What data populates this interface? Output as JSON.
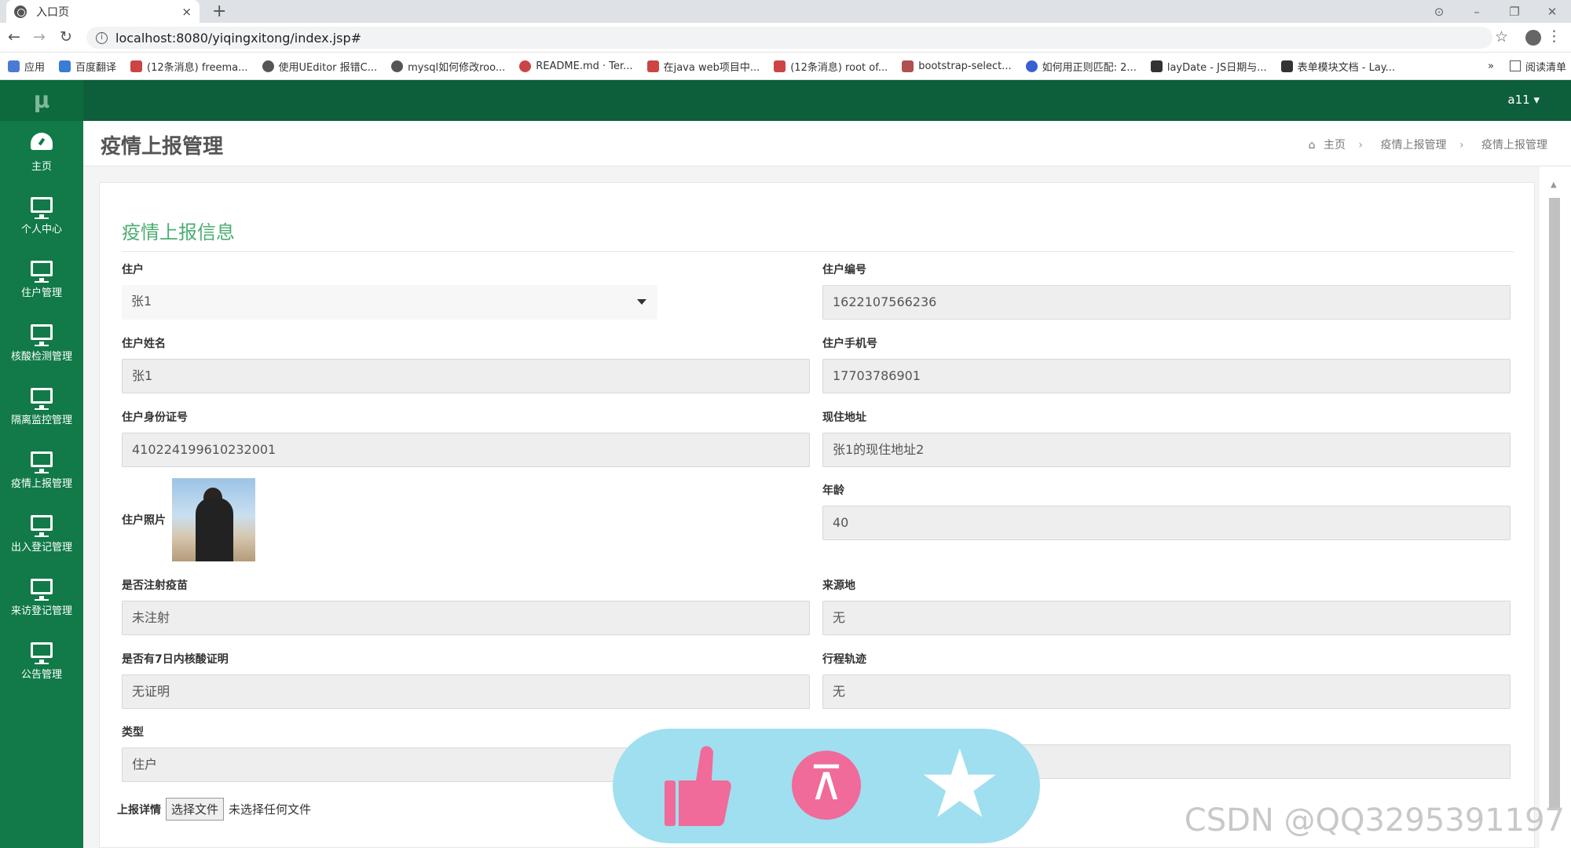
{
  "browser": {
    "tab_title": "入口页",
    "url": "localhost:8080/yiqingxitong/index.jsp#",
    "new_tab": "+",
    "close": "×"
  },
  "bookmarks": {
    "apps": "应用",
    "items": [
      "百度翻译",
      "(12条消息) freema...",
      "使用UEditor 报错C...",
      "mysql如何修改roo...",
      "README.md · Ter...",
      "在java web项目中...",
      "(12条消息) root of...",
      "bootstrap-select...",
      "如何用正则匹配: 2...",
      "layDate - JS日期与...",
      "表单模块文档 - Lay..."
    ],
    "more": "»",
    "reading_list": "阅读清单"
  },
  "sidebar": {
    "logo": "μ",
    "items": [
      {
        "label": "主页",
        "icon": "dashboard-icon"
      },
      {
        "label": "个人中心",
        "icon": "monitor-icon"
      },
      {
        "label": "住户管理",
        "icon": "monitor-icon"
      },
      {
        "label": "核酸检测管理",
        "icon": "monitor-icon"
      },
      {
        "label": "隔离监控管理",
        "icon": "monitor-icon"
      },
      {
        "label": "疫情上报管理",
        "icon": "monitor-icon"
      },
      {
        "label": "出入登记管理",
        "icon": "monitor-icon"
      },
      {
        "label": "来访登记管理",
        "icon": "monitor-icon"
      },
      {
        "label": "公告管理",
        "icon": "monitor-icon"
      }
    ]
  },
  "topbar": {
    "user": "a11 ▾"
  },
  "header": {
    "title": "疫情上报管理",
    "breadcrumb": [
      "主页",
      "疫情上报管理",
      "疫情上报管理"
    ]
  },
  "form": {
    "section_title": "疫情上报信息",
    "resident": {
      "label": "住户",
      "value": "张1"
    },
    "resident_no": {
      "label": "住户编号",
      "value": "1622107566236"
    },
    "name": {
      "label": "住户姓名",
      "value": "张1"
    },
    "phone": {
      "label": "住户手机号",
      "value": "17703786901"
    },
    "id_card": {
      "label": "住户身份证号",
      "value": "410224199610232001"
    },
    "address": {
      "label": "现住地址",
      "value": "张1的现住地址2"
    },
    "photo": {
      "label": "住户照片"
    },
    "age": {
      "label": "年龄",
      "value": "40"
    },
    "vaccinated": {
      "label": "是否注射疫苗",
      "value": "未注射"
    },
    "origin": {
      "label": "来源地",
      "value": "无"
    },
    "nucleic_proof": {
      "label": "是否有7日内核酸证明",
      "value": "无证明"
    },
    "itinerary": {
      "label": "行程轨迹",
      "value": "无"
    },
    "type": {
      "label": "类型",
      "value": "住户"
    },
    "upload": {
      "label": "上报详情",
      "button": "选择文件",
      "status": "未选择任何文件"
    }
  },
  "watermark": "CSDN @QQ3295391197"
}
